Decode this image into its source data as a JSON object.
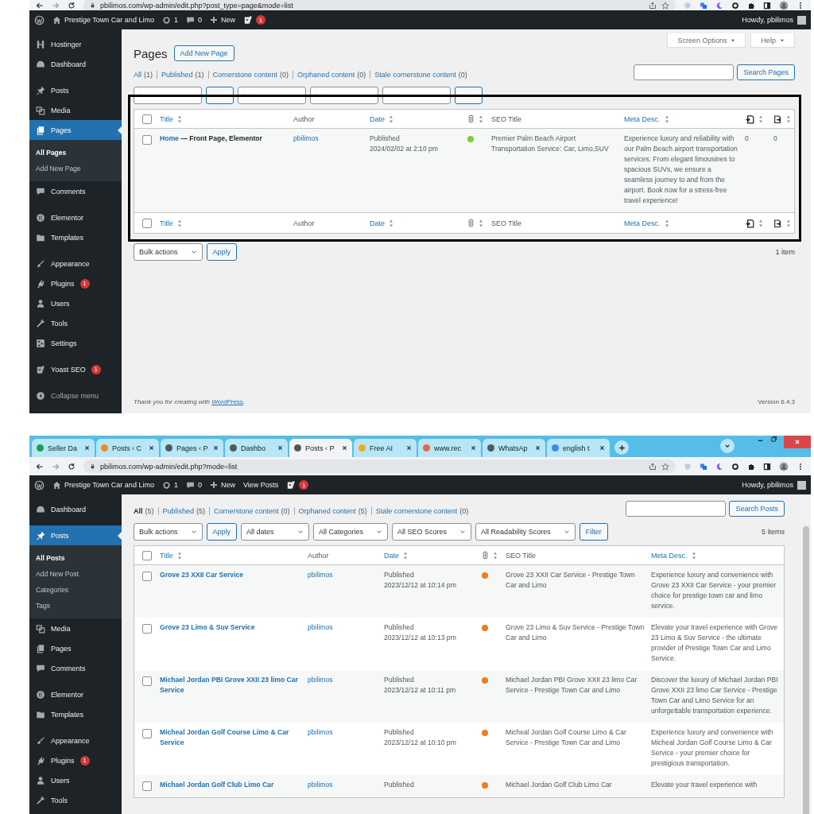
{
  "screenshots": [
    {
      "browser": {
        "url": "pbilimos.com/wp-admin/edit.php?post_type=page&mode=list"
      },
      "admin_bar": {
        "site": "Prestige Town Car and Limo",
        "updates": "1",
        "comments": "0",
        "new": "New",
        "notifications": "1",
        "greeting": "Howdy, pbilimos"
      },
      "sidebar": {
        "groups": [
          [
            {
              "label": "Hostinger",
              "kind": "hostinger",
              "selected": false
            },
            {
              "label": "Dashboard",
              "kind": "dashboard",
              "selected": false
            }
          ],
          [
            {
              "label": "Posts",
              "kind": "pin",
              "selected": false
            },
            {
              "label": "Media",
              "kind": "media",
              "selected": false
            },
            {
              "label": "Pages",
              "kind": "pages",
              "selected": true,
              "children": [
                {
                  "label": "All Pages",
                  "selected": true
                },
                {
                  "label": "Add New Page",
                  "selected": false
                }
              ]
            },
            {
              "label": "Comments",
              "kind": "comments",
              "selected": false
            }
          ],
          [
            {
              "label": "Elementor",
              "kind": "elementor",
              "selected": false
            },
            {
              "label": "Templates",
              "kind": "folder",
              "selected": false
            }
          ],
          [
            {
              "label": "Appearance",
              "kind": "brush",
              "selected": false
            },
            {
              "label": "Plugins",
              "kind": "plug",
              "selected": false,
              "badge": "1"
            },
            {
              "label": "Users",
              "kind": "user",
              "selected": false
            },
            {
              "label": "Tools",
              "kind": "wrench",
              "selected": false
            },
            {
              "label": "Settings",
              "kind": "settings",
              "selected": false
            }
          ],
          [
            {
              "label": "Yoast SEO",
              "kind": "yoast",
              "selected": false,
              "badge": "1"
            }
          ],
          [
            {
              "label": "Collapse menu",
              "kind": "collapse",
              "selected": false
            }
          ]
        ]
      },
      "header": {
        "title": "Pages",
        "add_new": "Add New Page",
        "screen_options": "Screen Options",
        "help": "Help"
      },
      "views": [
        {
          "label": "All",
          "count": "(1)",
          "selected": false
        },
        {
          "label": "Published",
          "count": "(1)",
          "selected": false
        },
        {
          "label": "Cornerstone content",
          "count": "(0)",
          "selected": false
        },
        {
          "label": "Orphaned content",
          "count": "(0)",
          "selected": false
        },
        {
          "label": "Stale cornerstone content",
          "count": "(0)",
          "selected": false
        }
      ],
      "search": {
        "button": "Search Pages"
      },
      "filters": [
        {
          "kind": "select"
        },
        {
          "kind": "button"
        },
        {
          "kind": "select"
        },
        {
          "kind": "select"
        },
        {
          "kind": "select"
        },
        {
          "kind": "button"
        }
      ],
      "highlight": true,
      "table": {
        "columns": [
          {
            "kind": "check",
            "checked": false
          },
          {
            "kind": "title",
            "label": "Title"
          },
          {
            "kind": "author",
            "label": "Author"
          },
          {
            "kind": "date",
            "label": "Date"
          },
          {
            "kind": "score"
          },
          {
            "kind": "seo",
            "label": "SEO Title"
          },
          {
            "kind": "meta",
            "label": "Meta Desc."
          },
          {
            "kind": "links_out"
          },
          {
            "kind": "links_in"
          }
        ],
        "footer_columns": [
          {
            "kind": "check",
            "checked": false
          },
          {
            "kind": "title",
            "label": "Title"
          },
          {
            "kind": "author",
            "label": "Author"
          },
          {
            "kind": "date",
            "label": "Date"
          },
          {
            "kind": "score"
          },
          {
            "kind": "seo",
            "label": "SEO Title"
          },
          {
            "kind": "meta",
            "label": "Meta Desc."
          },
          {
            "kind": "links_out"
          },
          {
            "kind": "links_in"
          }
        ],
        "rows": [
          {
            "checked": false,
            "title": "Home",
            "title_suffix": "— Front Page, Elementor",
            "author": "pbilimos",
            "status": "Published",
            "date": "2024/02/02 at 2:10 pm",
            "color": "#7ad03a",
            "seo": "Premier Palm Beach Airport Transportation Service: Car, Limo,SUV",
            "meta": "Experience luxury and reliability with our Palm Beach airport transportation services. From elegant limousines to spacious SUVs, we ensure a seamless journey to and from the airport. Book now for a stress-free travel experience!",
            "links_out": "0",
            "links_in": "0"
          }
        ]
      },
      "bottom_actions": {
        "bulk": "Bulk actions",
        "apply": "Apply",
        "count": "1 item"
      },
      "footer": {
        "thanks": "Thank you for creating with",
        "link": "WordPress",
        "after_link": ".",
        "version": "Version 6.4.3"
      }
    },
    {
      "browser": {
        "url": "pbilimos.com/wp-admin/edit.php?mode=list",
        "tabs": [
          {
            "label": "Seller Da",
            "color": "#1e9e4a",
            "selected": false
          },
          {
            "label": "Posts ‹ C",
            "color": "#f08a24",
            "selected": false
          },
          {
            "label": "Pages ‹ P",
            "color": "#50575e",
            "selected": false
          },
          {
            "label": "Dashbo",
            "color": "#50575e",
            "selected": false
          },
          {
            "label": "Posts ‹ P",
            "color": "#50575e",
            "selected": true
          },
          {
            "label": "Free AI",
            "color": "#f5a623",
            "selected": false
          },
          {
            "label": "www.rec",
            "color": "#e8663d",
            "selected": false
          },
          {
            "label": "WhatsAp",
            "color": "#50575e",
            "selected": false
          },
          {
            "label": "english t",
            "color": "#4285f4",
            "selected": false
          }
        ]
      },
      "admin_bar": {
        "site": "Prestige Town Car and Limo",
        "updates": "1",
        "comments": "0",
        "new": "New",
        "view_link": "View Posts",
        "notifications": "1",
        "greeting": "Howdy, pbilimos"
      },
      "sidebar": {
        "groups": [
          [
            {
              "label": "Dashboard",
              "kind": "dashboard",
              "selected": false
            }
          ],
          [
            {
              "label": "Posts",
              "kind": "pin",
              "selected": true,
              "children": [
                {
                  "label": "All Posts",
                  "selected": true
                },
                {
                  "label": "Add New Post",
                  "selected": false
                },
                {
                  "label": "Categories",
                  "selected": false
                },
                {
                  "label": "Tags",
                  "selected": false
                }
              ]
            },
            {
              "label": "Media",
              "kind": "media",
              "selected": false
            },
            {
              "label": "Pages",
              "kind": "pages",
              "selected": false
            },
            {
              "label": "Comments",
              "kind": "comments",
              "selected": false
            }
          ],
          [
            {
              "label": "Elementor",
              "kind": "elementor",
              "selected": false
            },
            {
              "label": "Templates",
              "kind": "folder",
              "selected": false
            }
          ],
          [
            {
              "label": "Appearance",
              "kind": "brush",
              "selected": false
            },
            {
              "label": "Plugins",
              "kind": "plug",
              "selected": false,
              "badge": "1"
            },
            {
              "label": "Users",
              "kind": "user",
              "selected": false
            },
            {
              "label": "Tools",
              "kind": "wrench",
              "selected": false
            }
          ]
        ]
      },
      "views": [
        {
          "label": "All",
          "count": "(5)",
          "selected": true
        },
        {
          "label": "Published",
          "count": "(5)",
          "selected": false
        },
        {
          "label": "Cornerstone content",
          "count": "(0)",
          "selected": false
        },
        {
          "label": "Orphaned content",
          "count": "(5)",
          "selected": false
        },
        {
          "label": "Stale cornerstone content",
          "count": "(0)",
          "selected": false
        }
      ],
      "search": {
        "button": "Search Posts"
      },
      "filters": [
        {
          "kind": "select",
          "label": "Bulk actions"
        },
        {
          "kind": "button",
          "label": "Apply"
        },
        {
          "kind": "select",
          "label": "All dates"
        },
        {
          "kind": "select",
          "label": "All Categories"
        },
        {
          "kind": "select",
          "label": "All SEO Scores"
        },
        {
          "kind": "select",
          "label": "All Readability Scores"
        },
        {
          "kind": "button",
          "label": "Filter"
        }
      ],
      "item_count": "5 items",
      "table": {
        "columns": [
          {
            "kind": "check",
            "checked": false
          },
          {
            "kind": "title",
            "label": "Title"
          },
          {
            "kind": "author",
            "label": "Author"
          },
          {
            "kind": "date",
            "label": "Date"
          },
          {
            "kind": "score"
          },
          {
            "kind": "seo",
            "label": "SEO Title"
          },
          {
            "kind": "meta",
            "label": "Meta Desc."
          }
        ],
        "rows": [
          {
            "checked": false,
            "title": "Grove 23 XXII Car Service",
            "author": "pbilimos",
            "status": "Published",
            "date": "2023/12/12 at 10:14 pm",
            "color": "#ee7c1b",
            "seo": "Grove 23 XXII Car Service - Prestige Town Car and Limo",
            "meta": "Experience luxury and convenience with Grove 23 XXII Car Service - your premier choice for prestige town car and limo service."
          },
          {
            "checked": false,
            "title": "Grove 23 Limo & Suv Service",
            "author": "pbilimos",
            "status": "Published",
            "date": "2023/12/12 at 10:13 pm",
            "color": "#ee7c1b",
            "seo": "Grove 23 Limo & Suv Service - Prestige Town Car and Limo",
            "meta": "Elevate your travel experience with Grove 23 Limo & Suv Service - the ultimate provider of Prestige Town Car and Limo Service."
          },
          {
            "checked": false,
            "title": "Michael Jordan PBI Grove XXII 23 limo Car Service",
            "author": "pbilimos",
            "status": "Published",
            "date": "2023/12/12 at 10:11 pm",
            "color": "#ee7c1b",
            "seo": "Michael Jordan PBI Grove XXII 23 limo Car Service - Prestige Town Car and Limo",
            "meta": "Discover the luxury of Michael Jordan PBI Grove XXII 23 limo Car Service - Prestige Town Car and Limo Service for an unforgettable transportation experience."
          },
          {
            "checked": false,
            "title": "Micheal Jordan Golf Course Limo & Car Service",
            "author": "pbilimos",
            "status": "Published",
            "date": "2023/12/12 at 10:10 pm",
            "color": "#ee7c1b",
            "seo": "Micheal Jordan Golf Course Limo & Car Service - Prestige Town Car and Limo",
            "meta": "Experience luxury and convenience with Micheal Jordan Golf Course Limo & Car Service - your premier choice for prestigious transportation."
          },
          {
            "checked": false,
            "title": "Michael Jordan Golf Club Limo Car",
            "author": "pbilimos",
            "status": "Published",
            "color": "#ee7c1b",
            "seo": "Michael Jordan Golf Club Limo Car",
            "meta": "Elevate your travel experience with"
          }
        ]
      }
    }
  ]
}
